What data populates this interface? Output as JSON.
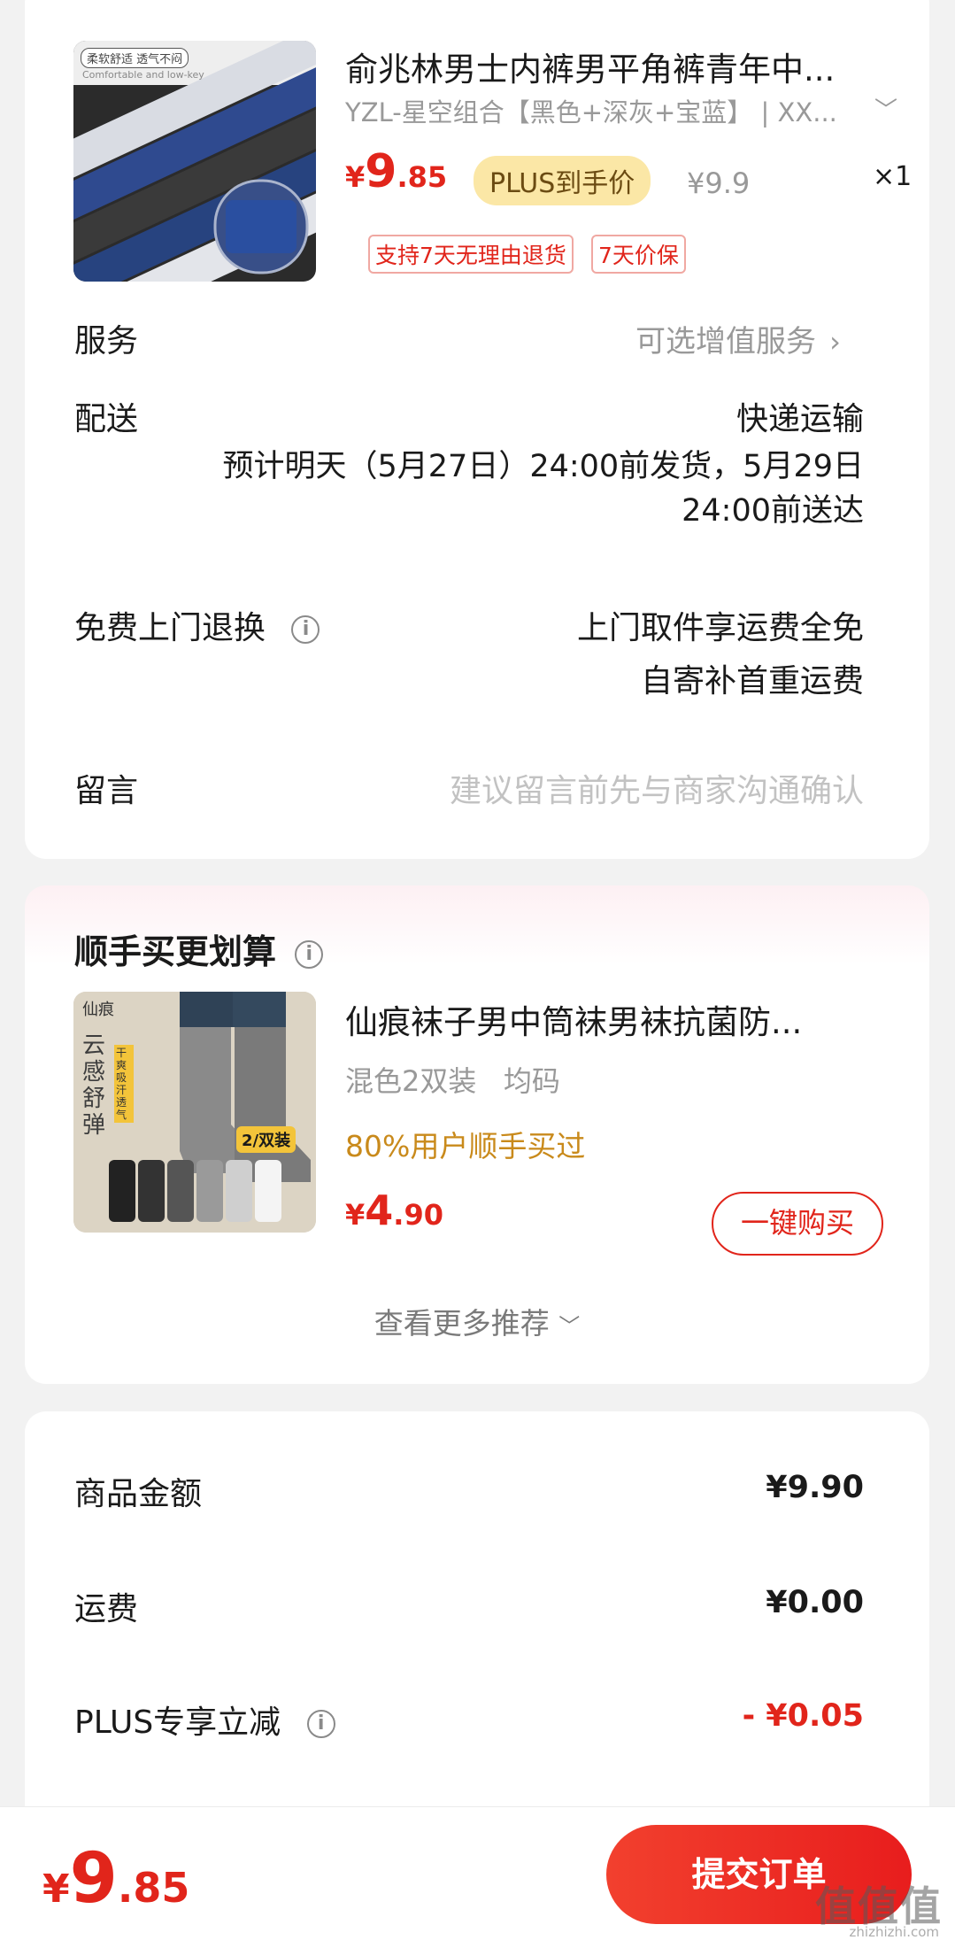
{
  "product": {
    "title": "俞兆林男士内裤男平角裤青年中...",
    "variant": "YZL-星空组合【黑色+深灰+宝蓝】 | XX...",
    "price_currency": "¥",
    "price_int": "9",
    "price_dec": ".85",
    "plus_tag": "PLUS到手价",
    "original_price": "¥9.9",
    "quantity": "×1",
    "tags": [
      "支持7天无理由退货",
      "7天价保"
    ],
    "image_texts": [
      "柔软舒适 透气不闷",
      "Comfortable and low-key"
    ]
  },
  "service": {
    "label": "服务",
    "value": "可选增值服务"
  },
  "delivery": {
    "label": "配送",
    "method": "快递运输",
    "estimate_line1": "预计明天（5月27日）24:00前发货，5月29日",
    "estimate_line2": "24:00前送达"
  },
  "return": {
    "label": "免费上门退换",
    "line1": "上门取件享运费全免",
    "line2": "自寄补首重运费"
  },
  "message": {
    "label": "留言",
    "placeholder": "建议留言前先与商家沟通确认"
  },
  "addon": {
    "section_title": "顺手买更划算",
    "title": "仙痕袜子男中筒袜男袜抗菌防...",
    "variant": "混色2双装   均码",
    "social": "80%用户顺手买过",
    "price_currency": "¥",
    "price_int": "4",
    "price_dec": ".90",
    "buy_button": "一键购买",
    "more": "查看更多推荐",
    "image_texts": {
      "brand": "仙痕",
      "slogan": "云感舒弹",
      "badge": "2/双装",
      "feature": "干爽吸汗透气"
    }
  },
  "summary": {
    "rows": [
      {
        "label": "商品金额",
        "value": "¥9.90"
      },
      {
        "label": "运费",
        "value": "¥0.00"
      },
      {
        "label": "PLUS专享立减",
        "value": "- ¥0.05"
      }
    ]
  },
  "bottom": {
    "total_currency": "¥",
    "total_int": "9",
    "total_dec": ".85",
    "submit": "提交订单"
  },
  "watermark": {
    "logo": "值值值",
    "site": "zhizhizhi.com"
  },
  "colors": {
    "accent": "#e1251b",
    "plus_bg": "#fbe7a6",
    "social": "#c98a1b"
  }
}
